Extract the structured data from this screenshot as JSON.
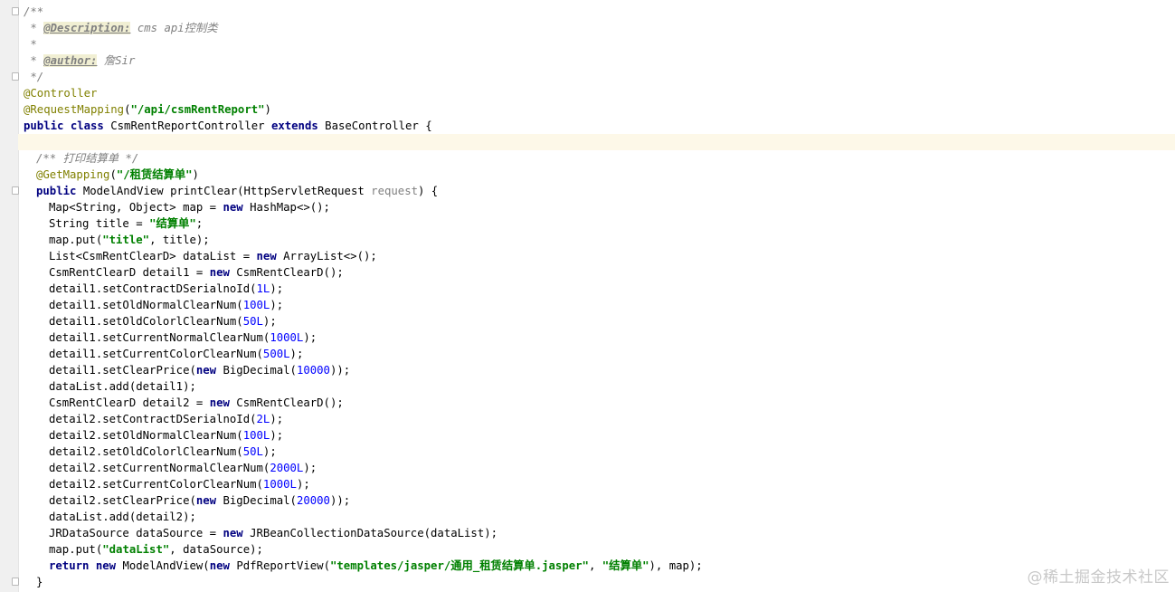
{
  "editor": {
    "lines": [
      {
        "indent": 0,
        "tokens": [
          {
            "t": "cm",
            "v": "/**"
          }
        ]
      },
      {
        "indent": 0,
        "tokens": [
          {
            "t": "cm",
            "v": " * "
          },
          {
            "t": "tag",
            "v": "@Description:"
          },
          {
            "t": "cm",
            "v": " cms api控制类"
          }
        ]
      },
      {
        "indent": 0,
        "tokens": [
          {
            "t": "cm",
            "v": " *"
          }
        ]
      },
      {
        "indent": 0,
        "tokens": [
          {
            "t": "cm",
            "v": " * "
          },
          {
            "t": "tag",
            "v": "@author:"
          },
          {
            "t": "cm",
            "v": " 詹Sir"
          }
        ]
      },
      {
        "indent": 0,
        "tokens": [
          {
            "t": "cm",
            "v": " */"
          }
        ]
      },
      {
        "indent": 0,
        "tokens": [
          {
            "t": "ann",
            "v": "@Controller"
          }
        ]
      },
      {
        "indent": 0,
        "tokens": [
          {
            "t": "ann",
            "v": "@RequestMapping"
          },
          {
            "t": "ident",
            "v": "("
          },
          {
            "t": "str",
            "v": "\"/api/csmRentReport\""
          },
          {
            "t": "ident",
            "v": ")"
          }
        ]
      },
      {
        "indent": 0,
        "tokens": [
          {
            "t": "kw",
            "v": "public class"
          },
          {
            "t": "ident",
            "v": " CsmRentReportController "
          },
          {
            "t": "kw",
            "v": "extends"
          },
          {
            "t": "ident",
            "v": " BaseController {"
          }
        ]
      },
      {
        "indent": 0,
        "current": true,
        "tokens": []
      },
      {
        "indent": 1,
        "tokens": [
          {
            "t": "cm",
            "v": "/** 打印结算单 */"
          }
        ]
      },
      {
        "indent": 1,
        "tokens": [
          {
            "t": "ann",
            "v": "@GetMapping"
          },
          {
            "t": "ident",
            "v": "("
          },
          {
            "t": "str",
            "v": "\"/租赁结算单\""
          },
          {
            "t": "ident",
            "v": ")"
          }
        ]
      },
      {
        "indent": 1,
        "tokens": [
          {
            "t": "kw",
            "v": "public"
          },
          {
            "t": "ident",
            "v": " ModelAndView printClear(HttpServletRequest "
          },
          {
            "t": "param",
            "v": "request"
          },
          {
            "t": "ident",
            "v": ") {"
          }
        ]
      },
      {
        "indent": 2,
        "tokens": [
          {
            "t": "ident",
            "v": "Map<String, Object> map = "
          },
          {
            "t": "kw",
            "v": "new"
          },
          {
            "t": "ident",
            "v": " HashMap<>();"
          }
        ]
      },
      {
        "indent": 2,
        "tokens": [
          {
            "t": "ident",
            "v": "String title = "
          },
          {
            "t": "str",
            "v": "\"结算单\""
          },
          {
            "t": "ident",
            "v": ";"
          }
        ]
      },
      {
        "indent": 2,
        "tokens": [
          {
            "t": "ident",
            "v": "map.put("
          },
          {
            "t": "str",
            "v": "\"title\""
          },
          {
            "t": "ident",
            "v": ", title);"
          }
        ]
      },
      {
        "indent": 2,
        "tokens": [
          {
            "t": "ident",
            "v": "List<CsmRentClearD> dataList = "
          },
          {
            "t": "kw",
            "v": "new"
          },
          {
            "t": "ident",
            "v": " ArrayList<>();"
          }
        ]
      },
      {
        "indent": 2,
        "tokens": [
          {
            "t": "ident",
            "v": "CsmRentClearD detail1 = "
          },
          {
            "t": "kw",
            "v": "new"
          },
          {
            "t": "ident",
            "v": " CsmRentClearD();"
          }
        ]
      },
      {
        "indent": 2,
        "tokens": [
          {
            "t": "ident",
            "v": "detail1.setContractDSerialnoId("
          },
          {
            "t": "num",
            "v": "1L"
          },
          {
            "t": "ident",
            "v": ");"
          }
        ]
      },
      {
        "indent": 2,
        "tokens": [
          {
            "t": "ident",
            "v": "detail1.setOldNormalClearNum("
          },
          {
            "t": "num",
            "v": "100L"
          },
          {
            "t": "ident",
            "v": ");"
          }
        ]
      },
      {
        "indent": 2,
        "tokens": [
          {
            "t": "ident",
            "v": "detail1.setOldColorlClearNum("
          },
          {
            "t": "num",
            "v": "50L"
          },
          {
            "t": "ident",
            "v": ");"
          }
        ]
      },
      {
        "indent": 2,
        "tokens": [
          {
            "t": "ident",
            "v": "detail1.setCurrentNormalClearNum("
          },
          {
            "t": "num",
            "v": "1000L"
          },
          {
            "t": "ident",
            "v": ");"
          }
        ]
      },
      {
        "indent": 2,
        "tokens": [
          {
            "t": "ident",
            "v": "detail1.setCurrentColorClearNum("
          },
          {
            "t": "num",
            "v": "500L"
          },
          {
            "t": "ident",
            "v": ");"
          }
        ]
      },
      {
        "indent": 2,
        "tokens": [
          {
            "t": "ident",
            "v": "detail1.setClearPrice("
          },
          {
            "t": "kw",
            "v": "new"
          },
          {
            "t": "ident",
            "v": " BigDecimal("
          },
          {
            "t": "num",
            "v": "10000"
          },
          {
            "t": "ident",
            "v": "));"
          }
        ]
      },
      {
        "indent": 2,
        "tokens": [
          {
            "t": "ident",
            "v": "dataList.add(detail1);"
          }
        ]
      },
      {
        "indent": 2,
        "tokens": [
          {
            "t": "ident",
            "v": "CsmRentClearD detail2 = "
          },
          {
            "t": "kw",
            "v": "new"
          },
          {
            "t": "ident",
            "v": " CsmRentClearD();"
          }
        ]
      },
      {
        "indent": 2,
        "tokens": [
          {
            "t": "ident",
            "v": "detail2.setContractDSerialnoId("
          },
          {
            "t": "num",
            "v": "2L"
          },
          {
            "t": "ident",
            "v": ");"
          }
        ]
      },
      {
        "indent": 2,
        "tokens": [
          {
            "t": "ident",
            "v": "detail2.setOldNormalClearNum("
          },
          {
            "t": "num",
            "v": "100L"
          },
          {
            "t": "ident",
            "v": ");"
          }
        ]
      },
      {
        "indent": 2,
        "tokens": [
          {
            "t": "ident",
            "v": "detail2.setOldColorlClearNum("
          },
          {
            "t": "num",
            "v": "50L"
          },
          {
            "t": "ident",
            "v": ");"
          }
        ]
      },
      {
        "indent": 2,
        "tokens": [
          {
            "t": "ident",
            "v": "detail2.setCurrentNormalClearNum("
          },
          {
            "t": "num",
            "v": "2000L"
          },
          {
            "t": "ident",
            "v": ");"
          }
        ]
      },
      {
        "indent": 2,
        "tokens": [
          {
            "t": "ident",
            "v": "detail2.setCurrentColorClearNum("
          },
          {
            "t": "num",
            "v": "1000L"
          },
          {
            "t": "ident",
            "v": ");"
          }
        ]
      },
      {
        "indent": 2,
        "tokens": [
          {
            "t": "ident",
            "v": "detail2.setClearPrice("
          },
          {
            "t": "kw",
            "v": "new"
          },
          {
            "t": "ident",
            "v": " BigDecimal("
          },
          {
            "t": "num",
            "v": "20000"
          },
          {
            "t": "ident",
            "v": "));"
          }
        ]
      },
      {
        "indent": 2,
        "tokens": [
          {
            "t": "ident",
            "v": "dataList.add(detail2);"
          }
        ]
      },
      {
        "indent": 2,
        "tokens": [
          {
            "t": "ident",
            "v": "JRDataSource dataSource = "
          },
          {
            "t": "kw",
            "v": "new"
          },
          {
            "t": "ident",
            "v": " JRBeanCollectionDataSource(dataList);"
          }
        ]
      },
      {
        "indent": 2,
        "tokens": [
          {
            "t": "ident",
            "v": "map.put("
          },
          {
            "t": "str",
            "v": "\"dataList\""
          },
          {
            "t": "ident",
            "v": ", dataSource);"
          }
        ]
      },
      {
        "indent": 2,
        "tokens": [
          {
            "t": "kw",
            "v": "return new"
          },
          {
            "t": "ident",
            "v": " ModelAndView("
          },
          {
            "t": "kw",
            "v": "new"
          },
          {
            "t": "ident",
            "v": " PdfReportView("
          },
          {
            "t": "str",
            "v": "\"templates/jasper/通用_租赁结算单.jasper\""
          },
          {
            "t": "ident",
            "v": ", "
          },
          {
            "t": "str",
            "v": "\"结算单\""
          },
          {
            "t": "ident",
            "v": "), map);"
          }
        ]
      },
      {
        "indent": 1,
        "tokens": [
          {
            "t": "ident",
            "v": "}"
          }
        ]
      }
    ]
  },
  "watermark": "@稀土掘金技术社区"
}
